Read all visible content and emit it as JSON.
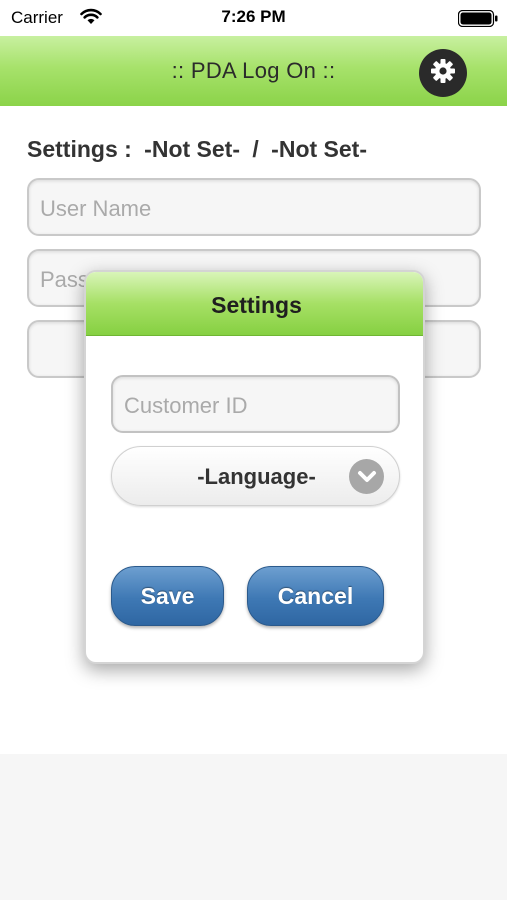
{
  "status_bar": {
    "carrier": "Carrier",
    "time": "7:26 PM",
    "icons": [
      "wifi-icon",
      "battery-icon"
    ]
  },
  "header": {
    "title": ":: PDA Log On ::",
    "settings_icon": "gear-icon"
  },
  "login": {
    "settings_label": "Settings :",
    "customer_value": "-Not Set-",
    "separator": "/",
    "language_value": "-Not Set-",
    "username_placeholder": "User Name",
    "password_placeholder": "Pass"
  },
  "dialog": {
    "title": "Settings",
    "customer_placeholder": "Customer ID",
    "language_selected": "-Language-",
    "save_label": "Save",
    "cancel_label": "Cancel"
  },
  "colors": {
    "header_green": "#a7e26b",
    "button_blue": "#3e78b4"
  }
}
